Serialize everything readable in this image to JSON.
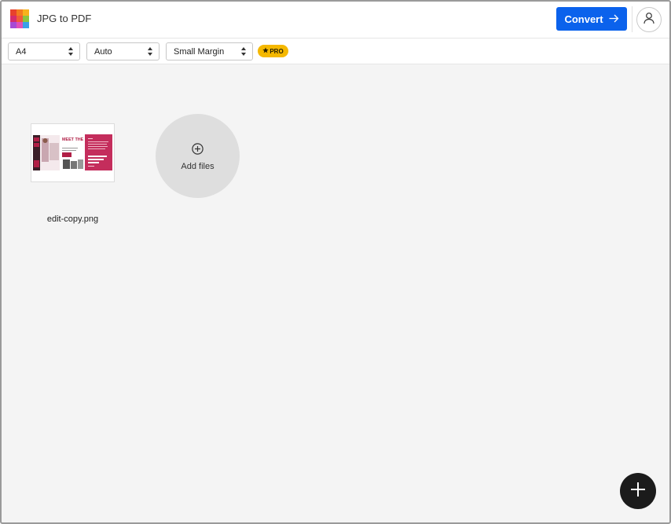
{
  "header": {
    "app_title": "JPG to PDF",
    "logo_icon": "app-grid-logo-icon",
    "convert_label": "Convert",
    "convert_icon": "arrow-right-icon",
    "account_icon": "user-icon",
    "accent_color": "#0b62ec"
  },
  "toolbar": {
    "page_size": "A4",
    "orientation": "Auto",
    "margin": "Small Margin",
    "pro_badge": "PRO",
    "pro_badge_icon": "star-icon",
    "pro_badge_color": "#f5b800"
  },
  "files": [
    {
      "name": "edit-copy.png",
      "thumbnail_text": "MEET THE BOXERS"
    }
  ],
  "add_files": {
    "label": "Add files",
    "icon": "plus-circle-icon"
  },
  "fab": {
    "icon": "plus-icon"
  }
}
